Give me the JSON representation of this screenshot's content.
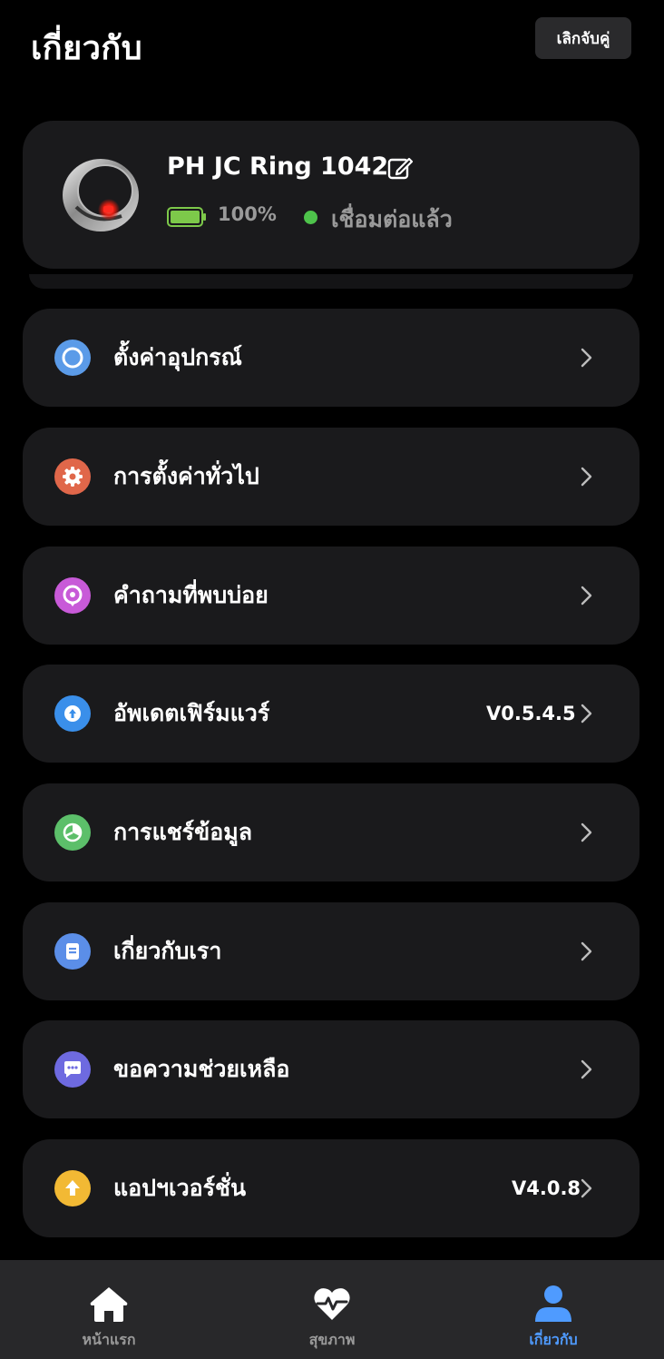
{
  "header": {
    "title": "เกี่ยวกับ",
    "unpair_label": "เลิกจับคู่"
  },
  "device": {
    "name": "PH JC Ring 1042",
    "battery_percent": "100%",
    "battery_level": 1.0,
    "status": "เชื่อมต่อแล้ว",
    "status_color": "#4ec34b",
    "image_icon": "smart-ring-icon",
    "edit_icon": "edit-icon"
  },
  "menu": [
    {
      "label": "ตั้งค่าอุปกรณ์",
      "value": "",
      "icon": "ring-circle-icon",
      "color": "#5b9be8"
    },
    {
      "label": "การตั้งค่าทั่วไป",
      "value": "",
      "icon": "gear-icon",
      "color": "#e0674a"
    },
    {
      "label": "คำถามที่พบบ่อย",
      "value": "",
      "icon": "question-icon",
      "color": "#c85ad8"
    },
    {
      "label": "อัพเดตเฟิร์มแวร์",
      "value": "V0.5.4.5",
      "icon": "firmware-update-icon",
      "color": "#3a8fea"
    },
    {
      "label": "การแชร์ข้อมูล",
      "value": "",
      "icon": "share-data-icon",
      "color": "#5cbf6a"
    },
    {
      "label": "เกี่ยวกับเรา",
      "value": "",
      "icon": "info-card-icon",
      "color": "#5b8ee8"
    },
    {
      "label": "ขอความช่วยเหลือ",
      "value": "",
      "icon": "chat-help-icon",
      "color": "#6e6ae0"
    },
    {
      "label": "แอปฯเวอร์ชั่น",
      "value": "V4.0.8",
      "icon": "app-version-icon",
      "color": "#f2b934"
    }
  ],
  "tabbar": {
    "tabs": [
      {
        "label": "หน้าแรก",
        "icon": "home-icon",
        "active": false
      },
      {
        "label": "สุขภาพ",
        "icon": "heart-pulse-icon",
        "active": false
      },
      {
        "label": "เกี่ยวกับ",
        "icon": "person-icon",
        "active": true
      }
    ],
    "active_color": "#4f9bff"
  }
}
